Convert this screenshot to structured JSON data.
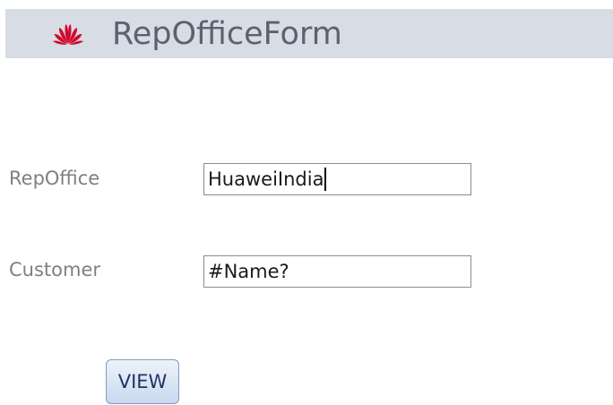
{
  "header": {
    "title": "RepOfficeForm",
    "logo_icon": "huawei-logo-icon",
    "background": "#d8dce4",
    "logo_color": "#cf0a2c"
  },
  "form": {
    "repoffice_label": "RepOffice",
    "repoffice_value": "HuaweiIndia",
    "customer_label": "Customer",
    "customer_value": "#Name?"
  },
  "actions": {
    "view_label": "VIEW"
  }
}
